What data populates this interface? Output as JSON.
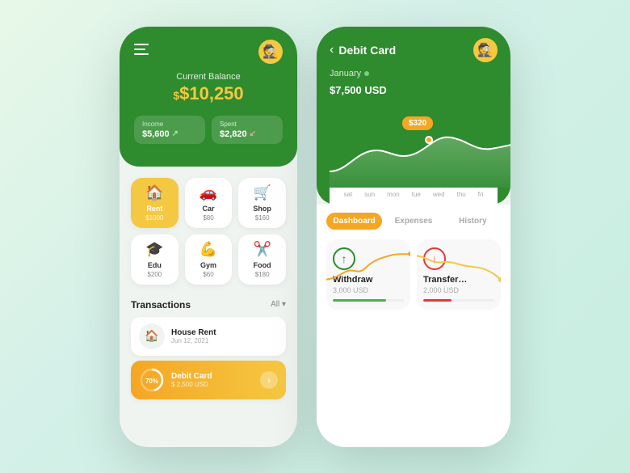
{
  "background": {
    "gradient": "linear-gradient(135deg, #e8f8e8, #c8eee0)"
  },
  "phone1": {
    "header": {
      "menu_icon": "≡",
      "avatar_emoji": "🕵️",
      "balance_label": "Current Balance",
      "balance_amount": "$10,250",
      "balance_dollar": "$",
      "income_label": "Income",
      "income_value": "$5,600",
      "spent_label": "Spent",
      "spent_value": "$2,820"
    },
    "categories": [
      {
        "name": "Rent",
        "amount": "$1000",
        "icon": "🏠",
        "active": true
      },
      {
        "name": "Car",
        "amount": "$80",
        "icon": "🚗",
        "active": false
      },
      {
        "name": "Shop",
        "amount": "$160",
        "icon": "🛒",
        "active": false
      },
      {
        "name": "Edu",
        "amount": "$200",
        "icon": "🎓",
        "active": false
      },
      {
        "name": "Gym",
        "amount": "$60",
        "icon": "💪",
        "active": false
      },
      {
        "name": "Food",
        "amount": "$180",
        "icon": "✂",
        "active": false
      }
    ],
    "transactions": {
      "title": "Transactions",
      "filter": "All",
      "items": [
        {
          "name": "House Rent",
          "sub": "Jun 12, 2021",
          "icon": "🏠",
          "style": "normal"
        },
        {
          "name": "Debit Card",
          "sub": "$ 2,500 USD",
          "icon": "💳",
          "style": "orange",
          "progress": 70
        }
      ]
    }
  },
  "phone2": {
    "header": {
      "back_label": "<",
      "title": "Debit Card",
      "avatar_emoji": "🕵️",
      "month": "January",
      "month_dot_color": "#7fcc7f",
      "amount": "$7,500 USD",
      "tooltip_value": "$320",
      "x_labels": [
        "sat",
        "sun",
        "mon",
        "tue",
        "wed",
        "thu",
        "fri"
      ]
    },
    "tabs": [
      {
        "label": "Dashboard",
        "active": true
      },
      {
        "label": "Expenses",
        "active": false
      },
      {
        "label": "History",
        "active": false
      }
    ],
    "cards": [
      {
        "icon": "↑",
        "icon_style": "green",
        "title": "Withdraw",
        "sub": "3,000 USD",
        "bar_pct": 75,
        "bar_color": "fill-green"
      },
      {
        "icon": "↓",
        "icon_style": "red",
        "title": "Transfer",
        "sub": "2,000 USD",
        "bar_pct": 40,
        "bar_color": "fill-red"
      }
    ]
  }
}
